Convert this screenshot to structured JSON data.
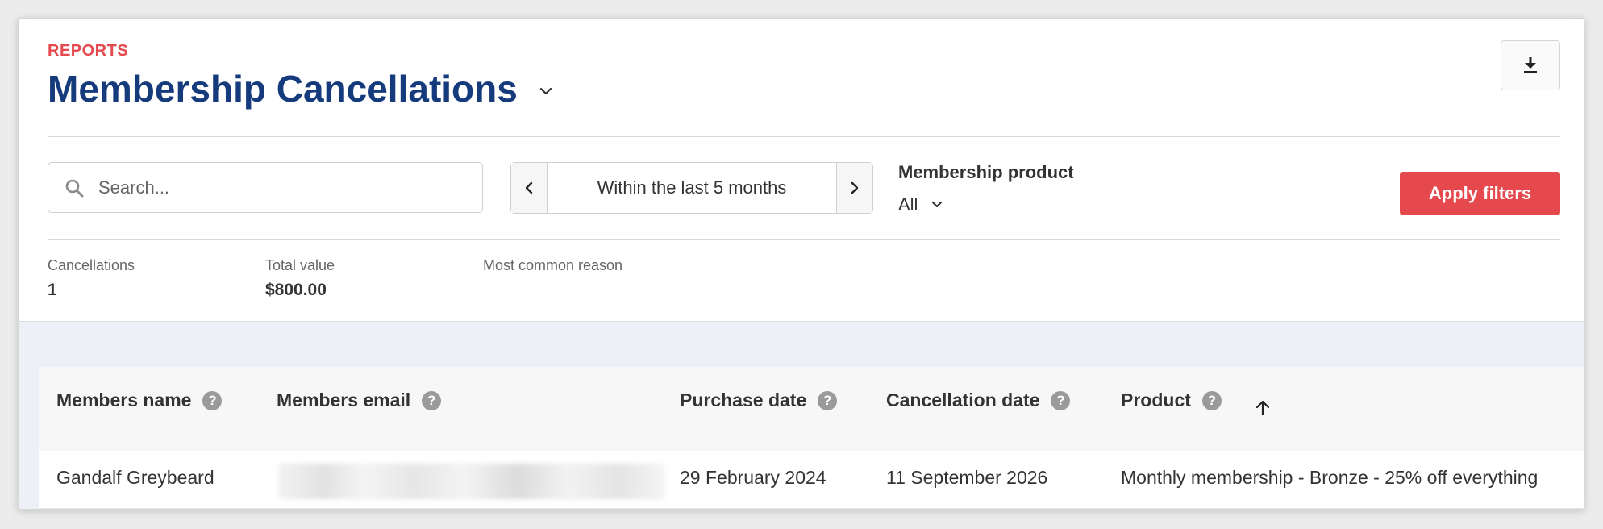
{
  "header": {
    "eyebrow": "REPORTS",
    "title": "Membership Cancellations"
  },
  "filters": {
    "search_placeholder": "Search...",
    "search_value": "",
    "date_range": "Within the last 5 months",
    "product_label": "Membership product",
    "product_value": "All",
    "apply_label": "Apply filters"
  },
  "stats": [
    {
      "label": "Cancellations",
      "value": "1"
    },
    {
      "label": "Total value",
      "value": "$800.00"
    },
    {
      "label": "Most common reason",
      "value": ""
    }
  ],
  "table": {
    "columns": [
      "Members name",
      "Members email",
      "Purchase date",
      "Cancellation date",
      "Product"
    ],
    "sort": {
      "column": "Product",
      "direction": "ascending"
    },
    "rows": [
      {
        "name": "Gandalf Greybeard",
        "email": "",
        "purchase_date": "29 February 2024",
        "cancellation_date": "11 September 2026",
        "product": "Monthly membership - Bronze - 25% off everything"
      }
    ]
  },
  "icons": {
    "download": "download-icon",
    "search": "search-icon",
    "title_dropdown": "chevron-down-icon",
    "help": "help-icon",
    "sort": "arrow-up-icon"
  },
  "colors": {
    "accent": "#e5484d",
    "title": "#163b7c",
    "table_background": "#eef0f8"
  }
}
